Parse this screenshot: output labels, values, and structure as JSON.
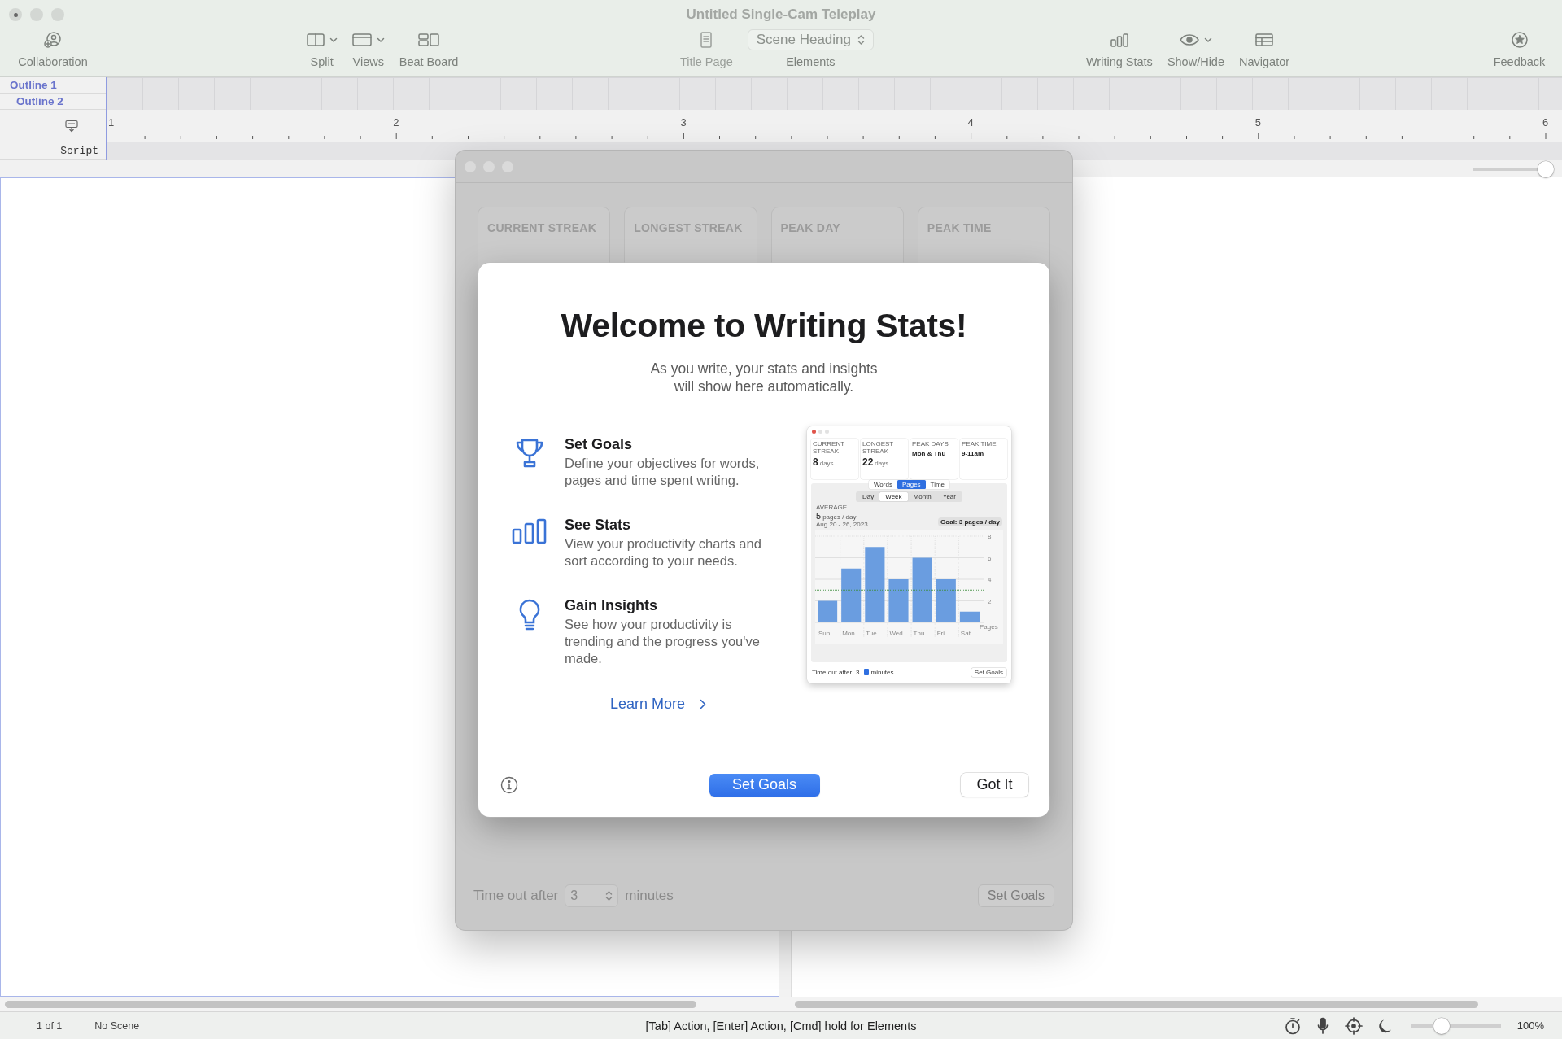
{
  "window": {
    "title": "Untitled Single-Cam Teleplay"
  },
  "toolbar_groups": [
    {
      "items": [
        {
          "kind": "collaboration",
          "label": "Collaboration",
          "menu": false,
          "disabled": false
        }
      ]
    },
    {
      "items": [
        {
          "kind": "split",
          "label": "Split",
          "menu": true,
          "disabled": false
        },
        {
          "kind": "views",
          "label": "Views",
          "menu": true,
          "disabled": false
        },
        {
          "kind": "beat-board",
          "label": "Beat Board",
          "menu": false,
          "disabled": false
        }
      ]
    },
    {
      "items": [
        {
          "kind": "title-page",
          "label": "Title Page",
          "menu": false,
          "disabled": true
        },
        {
          "kind": "popup",
          "label": "Elements",
          "value": "Scene Heading",
          "disabled": false
        }
      ]
    },
    {
      "items": [
        {
          "kind": "writing-stats",
          "label": "Writing Stats",
          "menu": false,
          "disabled": false
        },
        {
          "kind": "show-hide",
          "label": "Show/Hide",
          "menu": true,
          "disabled": false
        },
        {
          "kind": "navigator",
          "label": "Navigator",
          "menu": false,
          "disabled": false
        }
      ]
    },
    {
      "items": [
        {
          "kind": "feedback",
          "label": "Feedback",
          "menu": false,
          "disabled": false
        }
      ]
    }
  ],
  "outline": [
    {
      "label": "Outline 1"
    },
    {
      "label": "Outline 2"
    }
  ],
  "ruler": {
    "marks": [
      "1",
      "2",
      "3",
      "4",
      "5",
      "6"
    ]
  },
  "script_label": "Script",
  "width_slider": {
    "level": 1
  },
  "stats_window": {
    "cards": [
      {
        "label": "CURRENT STREAK"
      },
      {
        "label": "LONGEST STREAK"
      },
      {
        "label": "PEAK DAY"
      },
      {
        "label": "PEAK TIME"
      }
    ],
    "timeout_label": "Time out after",
    "timeout_value": "3",
    "timeout_unit": "minutes",
    "button": "Set Goals"
  },
  "dialog": {
    "title": "Welcome to Writing Stats!",
    "subtitle": "As you write, your stats and insights will show here automatically.",
    "features": [
      {
        "kind": "goals",
        "title": "Set Goals",
        "text": "Define your objectives for words, pages and time spent writing."
      },
      {
        "kind": "stats",
        "title": "See Stats",
        "text": "View your productivity charts and sort according to your needs."
      },
      {
        "kind": "insights",
        "title": "Gain Insights",
        "text": "See how your productivity is trending and the progress you've made."
      }
    ],
    "link": "Learn More",
    "primary_button": "Set Goals",
    "secondary_button": "Got It",
    "preview": {
      "cards": [
        {
          "label": "CURRENT STREAK",
          "value": "8",
          "unit": "days"
        },
        {
          "label": "LONGEST STREAK",
          "value": "22",
          "unit": "days"
        },
        {
          "label": "PEAK DAYS",
          "value": "Mon & Thu"
        },
        {
          "label": "PEAK TIME",
          "value": "9-11am"
        }
      ],
      "metric_tabs": [
        {
          "label": "Words",
          "selected": false
        },
        {
          "label": "Pages",
          "selected": true
        },
        {
          "label": "Time",
          "selected": false
        }
      ],
      "period_tabs": [
        {
          "label": "Day",
          "selected": false
        },
        {
          "label": "Week",
          "selected": true
        },
        {
          "label": "Month",
          "selected": false
        },
        {
          "label": "Year",
          "selected": false
        }
      ],
      "average_label": "AVERAGE",
      "average_value": "5",
      "average_unit": "pages / day",
      "date_range": "Aug 20 - 26, 2023",
      "goal": "Goal: 3 pages / day",
      "chart_data": {
        "type": "bar",
        "categories": [
          "Sun",
          "Mon",
          "Tue",
          "Wed",
          "Thu",
          "Fri",
          "Sat"
        ],
        "values": [
          2,
          5,
          7,
          4,
          6,
          4,
          1
        ],
        "ylabel": "Pages",
        "ylim": [
          0,
          8
        ],
        "yticks": [
          2,
          4,
          6,
          8
        ],
        "grid": true,
        "ref_lines": [
          {
            "axis": "y",
            "value": 3
          }
        ]
      },
      "timeout_label": "Time out after",
      "timeout_value": "3",
      "timeout_unit": "minutes",
      "button": "Set Goals"
    }
  },
  "status_bar": {
    "page": "1 of 1",
    "scene": "No Scene",
    "hint": "[Tab] Action, [Enter] Action, [Cmd] hold for Elements",
    "zoom": {
      "level": 0.3
    },
    "zoom_label": "100%"
  }
}
